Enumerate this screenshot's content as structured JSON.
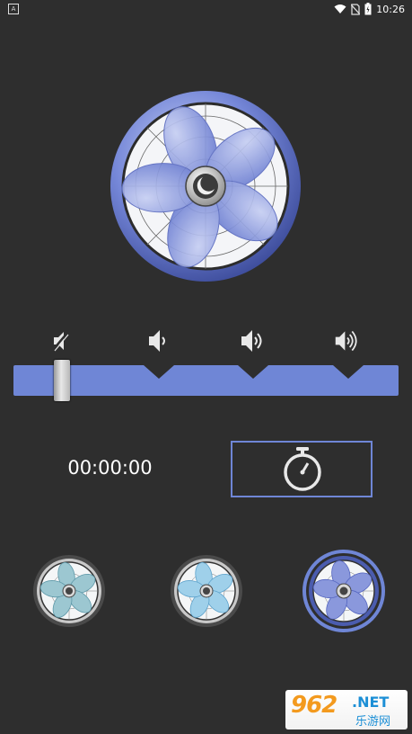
{
  "status_bar": {
    "app_icon_letter": "A",
    "time": "10:26",
    "icons": [
      "wifi-icon",
      "no-sim-icon",
      "battery-charging-icon"
    ]
  },
  "speed_levels": [
    {
      "name": "mute",
      "icon": "speaker-mute-icon"
    },
    {
      "name": "low",
      "icon": "speaker-low-icon"
    },
    {
      "name": "medium",
      "icon": "speaker-medium-icon"
    },
    {
      "name": "high",
      "icon": "speaker-high-icon"
    }
  ],
  "speed_slider": {
    "value_index": 0,
    "max_index": 3
  },
  "timer": {
    "display": "00:00:00",
    "button_icon": "stopwatch-icon"
  },
  "fan_styles": [
    {
      "name": "teal-fan",
      "selected": false,
      "blade_color": "#9cc7d1"
    },
    {
      "name": "light-blue-fan",
      "selected": false,
      "blade_color": "#9fd0ea"
    },
    {
      "name": "purple-blue-fan",
      "selected": true,
      "blade_color": "#7f8fd8"
    }
  ],
  "watermark": {
    "brand": "962",
    "suffix": ".NET",
    "site": "乐游网"
  },
  "colors": {
    "background": "#2e2e2e",
    "accent": "#6f86d6",
    "slider": "#6f86d6"
  }
}
